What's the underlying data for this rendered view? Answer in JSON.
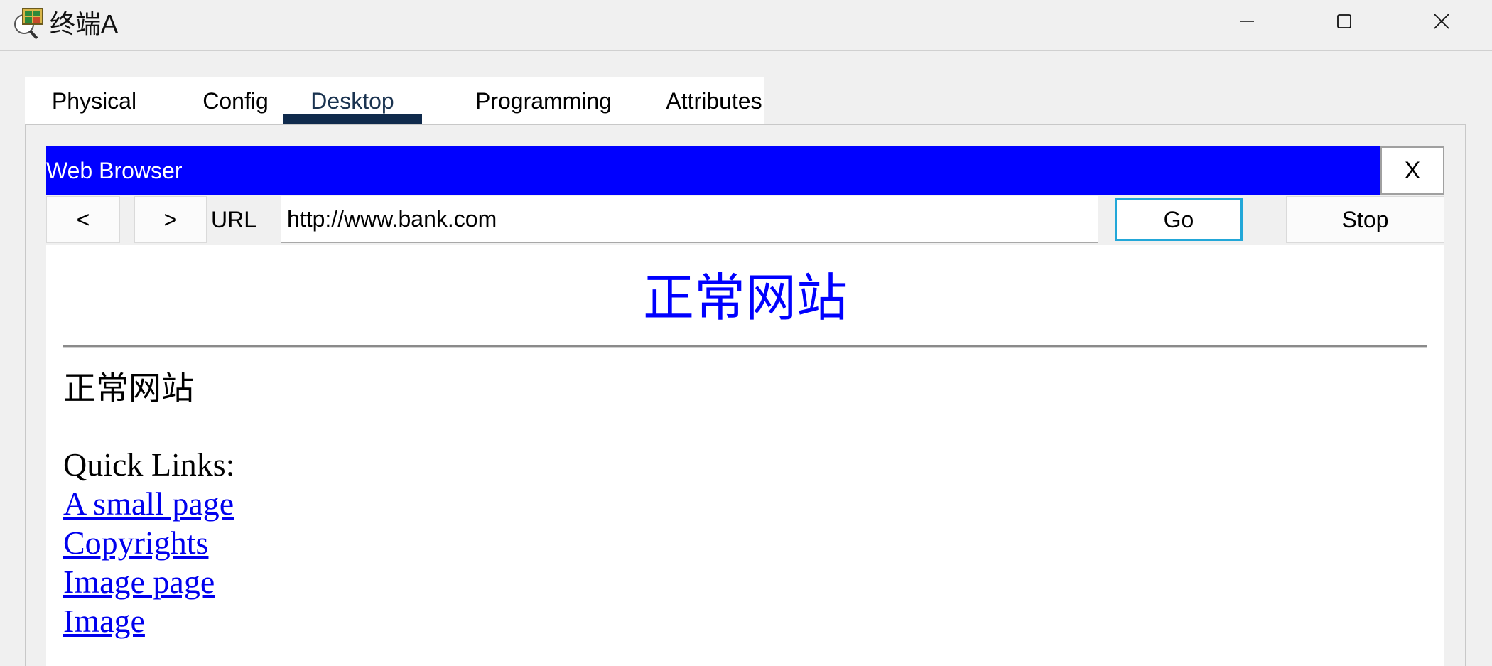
{
  "window": {
    "title": "终端A",
    "icon": "network-terminal-icon"
  },
  "tabs": [
    {
      "label": "Physical"
    },
    {
      "label": "Config"
    },
    {
      "label": "Desktop",
      "active": true
    },
    {
      "label": "Programming"
    },
    {
      "label": "Attributes"
    }
  ],
  "browser": {
    "title": "Web Browser",
    "close_label": "X",
    "back_label": "<",
    "forward_label": ">",
    "url_label": "URL",
    "url_value": "http://www.bank.com",
    "go_label": "Go",
    "stop_label": "Stop",
    "header_color": "#0000ff"
  },
  "page": {
    "heading": "正常网站",
    "subheading": "正常网站",
    "quick_links_label": "Quick Links:",
    "links": [
      {
        "label": "A small page"
      },
      {
        "label": "Copyrights"
      },
      {
        "label": "Image page"
      },
      {
        "label": "Image"
      }
    ],
    "link_color": "#0000ee",
    "heading_color": "#0000ff"
  }
}
